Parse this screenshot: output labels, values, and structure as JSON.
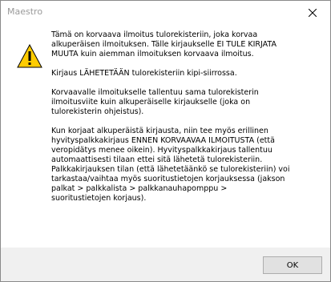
{
  "window": {
    "title": "Maestro"
  },
  "icon": {
    "name": "warning-icon",
    "fill": "#ffcc00",
    "stroke": "#000000"
  },
  "message": {
    "paragraphs": [
      "Tämä on korvaava ilmoitus tulorekisteriin, joka korvaa\nalkuperäisen ilmoituksen. Tälle kirjaukselle EI TULE KIRJATA\nMUUTA kuin aiemman ilmoituksen korvaava ilmoitus.",
      "Kirjaus LÄHETETÄÄN tulorekisteriin kipi-siirrossa.",
      "Korvaavalle ilmoitukselle tallentuu sama tulorekisterin\nilmoitusviite kuin alkuperäiselle kirjaukselle (joka on\ntulorekisterin ohjeistus).",
      "Kun korjaat alkuperäistä kirjausta, niin tee myös erillinen\nhyvityspalkkakirjaus ENNEN KORVAAVAA ILMOITUSTA (että\nveropidätys menee oikein). Hyvityspalkkakirjaus tallentuu\nautomaattisesti tilaan ettei sitä lähetetä tulorekisteriin.\nPalkkakirjauksen tilan (että lähetetäänkö se tulorekisteriin) voi\ntarkastaa/vaihtaa myös suoritustietojen korjauksessa (jakson\npalkat > palkkalista > palkkanauhapomppu >\nsuoritustietojen korjaus)."
    ]
  },
  "buttons": {
    "ok_label": "OK"
  }
}
